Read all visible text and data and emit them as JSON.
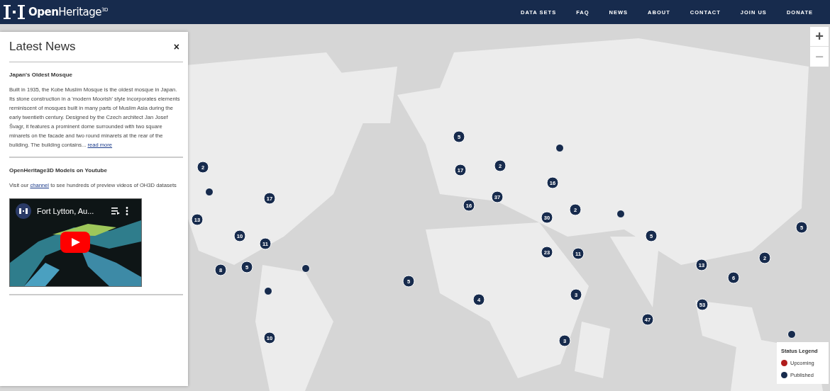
{
  "brand": {
    "name": "Open",
    "name_rest": "Heritage",
    "sup": "3D"
  },
  "nav": [
    "DATA SETS",
    "FAQ",
    "NEWS",
    "ABOUT",
    "CONTACT",
    "JOIN US",
    "DONATE"
  ],
  "news_panel": {
    "title": "Latest News",
    "close": "×",
    "items": [
      {
        "kind": "article",
        "title": "Japan's Oldest Mosque",
        "body": "Built in 1935, the Kobe Muslim Mosque is the oldest mosque in Japan. Its stone construction in a 'modern Moorish' style incorporates elements reminiscent of mosques built in many parts of Muslim Asia during the early twentieth century. Designed by the Czech architect Jan Josef Švagr, it features a prominent dome surrounded with two square minarets on the facade and two round minarets at the rear of the building. The building contains...",
        "link": "read more"
      },
      {
        "kind": "video",
        "title": "OpenHeritage3D Models on Youtube",
        "before": "Visit our",
        "link": "channel",
        "after": "to see hundreds of preview videos of OH3D datasets",
        "video_title": "Fort Lytton, Au..."
      }
    ]
  },
  "zoom": {
    "in": "+",
    "out": "−"
  },
  "markers": [
    {
      "kind": "cluster",
      "count": "5"
    },
    {
      "kind": "cluster",
      "count": "2"
    },
    {
      "kind": "point"
    },
    {
      "kind": "cluster",
      "count": "17"
    },
    {
      "kind": "cluster",
      "count": "2"
    },
    {
      "kind": "point"
    },
    {
      "kind": "cluster",
      "count": "17"
    },
    {
      "kind": "cluster",
      "count": "16"
    },
    {
      "kind": "cluster",
      "count": "37"
    },
    {
      "kind": "cluster",
      "count": "16"
    },
    {
      "kind": "cluster",
      "count": "2"
    },
    {
      "kind": "point"
    },
    {
      "kind": "cluster",
      "count": "13"
    },
    {
      "kind": "cluster",
      "count": "10"
    },
    {
      "kind": "cluster",
      "count": "30"
    },
    {
      "kind": "cluster",
      "count": "5"
    },
    {
      "kind": "cluster",
      "count": "5"
    },
    {
      "kind": "cluster",
      "count": "11"
    },
    {
      "kind": "cluster",
      "count": "23"
    },
    {
      "kind": "cluster",
      "count": "11"
    },
    {
      "kind": "cluster",
      "count": "2"
    },
    {
      "kind": "cluster",
      "count": "8"
    },
    {
      "kind": "cluster",
      "count": "5"
    },
    {
      "kind": "point"
    },
    {
      "kind": "cluster",
      "count": "13"
    },
    {
      "kind": "cluster",
      "count": "6"
    },
    {
      "kind": "cluster",
      "count": "5"
    },
    {
      "kind": "point"
    },
    {
      "kind": "cluster",
      "count": "3"
    },
    {
      "kind": "cluster",
      "count": "4"
    },
    {
      "kind": "cluster",
      "count": "53"
    },
    {
      "kind": "cluster",
      "count": "47"
    },
    {
      "kind": "cluster",
      "count": "10"
    },
    {
      "kind": "cluster",
      "count": "3"
    },
    {
      "kind": "point"
    }
  ],
  "legend": {
    "title": "Status Legend",
    "items": [
      {
        "label": "Upcoming",
        "color": "#b01c1c"
      },
      {
        "label": "Published",
        "color": "#172b4d"
      }
    ]
  }
}
